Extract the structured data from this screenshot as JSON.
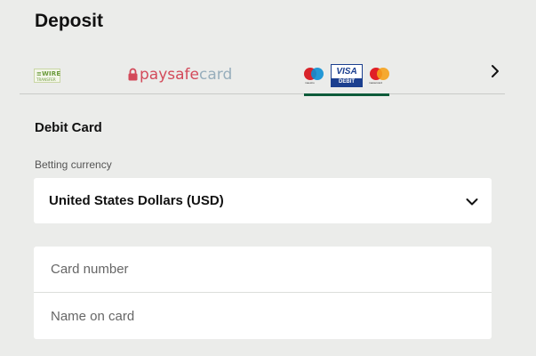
{
  "header": {
    "title": "Deposit"
  },
  "payment_methods": {
    "wire": {
      "line1": "≡WIRE",
      "line2": "TRANSFER"
    },
    "paysafe": {
      "part1": "paysafe",
      "part2": "card"
    },
    "debit": {
      "maestro_text": "maestro",
      "visa_text": "VISA",
      "debit_text": "DEBIT",
      "mastercard_text": "mastercard",
      "selected": true
    },
    "next_icon": "chevron-right-icon"
  },
  "form": {
    "section_title": "Debit Card",
    "currency_label": "Betting currency",
    "currency_value": "United States Dollars (USD)",
    "card_number_placeholder": "Card number",
    "name_on_card_placeholder": "Name on card"
  },
  "colors": {
    "background": "#ebecea",
    "accent_underline": "#0d5b3a",
    "visa_blue": "#1b3f8f",
    "paysafe_red": "#d34a5a"
  }
}
